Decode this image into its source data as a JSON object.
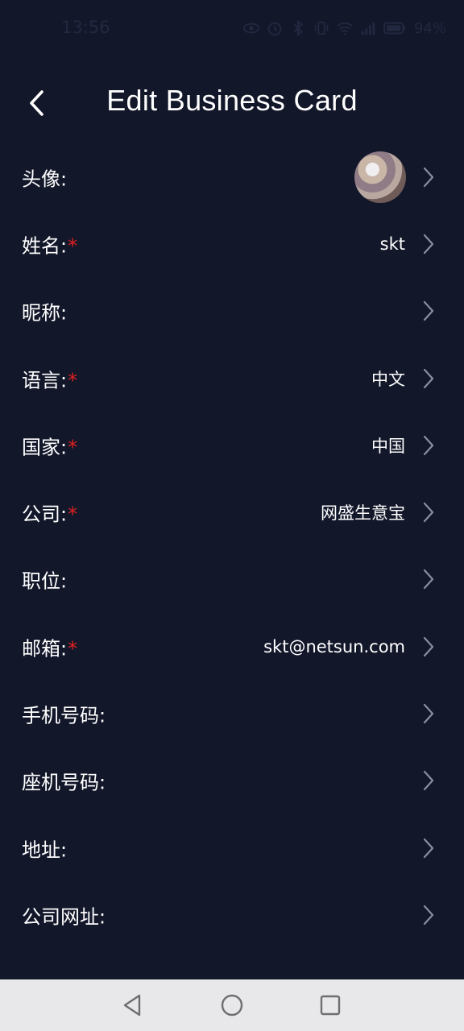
{
  "status_bar": {
    "time": "13:56",
    "battery": "94%",
    "icons": [
      "eye-icon",
      "alarm-icon",
      "bluetooth-icon",
      "vibrate-icon",
      "wifi-icon",
      "signal-icon",
      "battery-icon"
    ]
  },
  "header": {
    "back_icon": "chevron-left-icon",
    "title": "Edit Business Card"
  },
  "form": {
    "rows": [
      {
        "label": "头像:",
        "required": false,
        "value": "",
        "type": "avatar"
      },
      {
        "label": "姓名:",
        "required": true,
        "value": "skt"
      },
      {
        "label": "昵称:",
        "required": false,
        "value": ""
      },
      {
        "label": "语言:",
        "required": true,
        "value": "中文"
      },
      {
        "label": "国家:",
        "required": true,
        "value": "中国"
      },
      {
        "label": "公司:",
        "required": true,
        "value": "网盛生意宝"
      },
      {
        "label": "职位:",
        "required": false,
        "value": ""
      },
      {
        "label": "邮箱:",
        "required": true,
        "value": "skt@netsun.com"
      },
      {
        "label": "手机号码:",
        "required": false,
        "value": ""
      },
      {
        "label": "座机号码:",
        "required": false,
        "value": ""
      },
      {
        "label": "地址:",
        "required": false,
        "value": ""
      },
      {
        "label": "公司网址:",
        "required": false,
        "value": ""
      }
    ],
    "required_mark": "*"
  },
  "nav_bar": {
    "buttons": [
      "back-triangle-icon",
      "home-circle-icon",
      "recents-square-icon"
    ]
  },
  "colors": {
    "background": "#13172a",
    "text": "#ffffff",
    "required": "#e02020",
    "chevron": "#8a8ea0",
    "nav_bar": "#e8e8ea"
  }
}
